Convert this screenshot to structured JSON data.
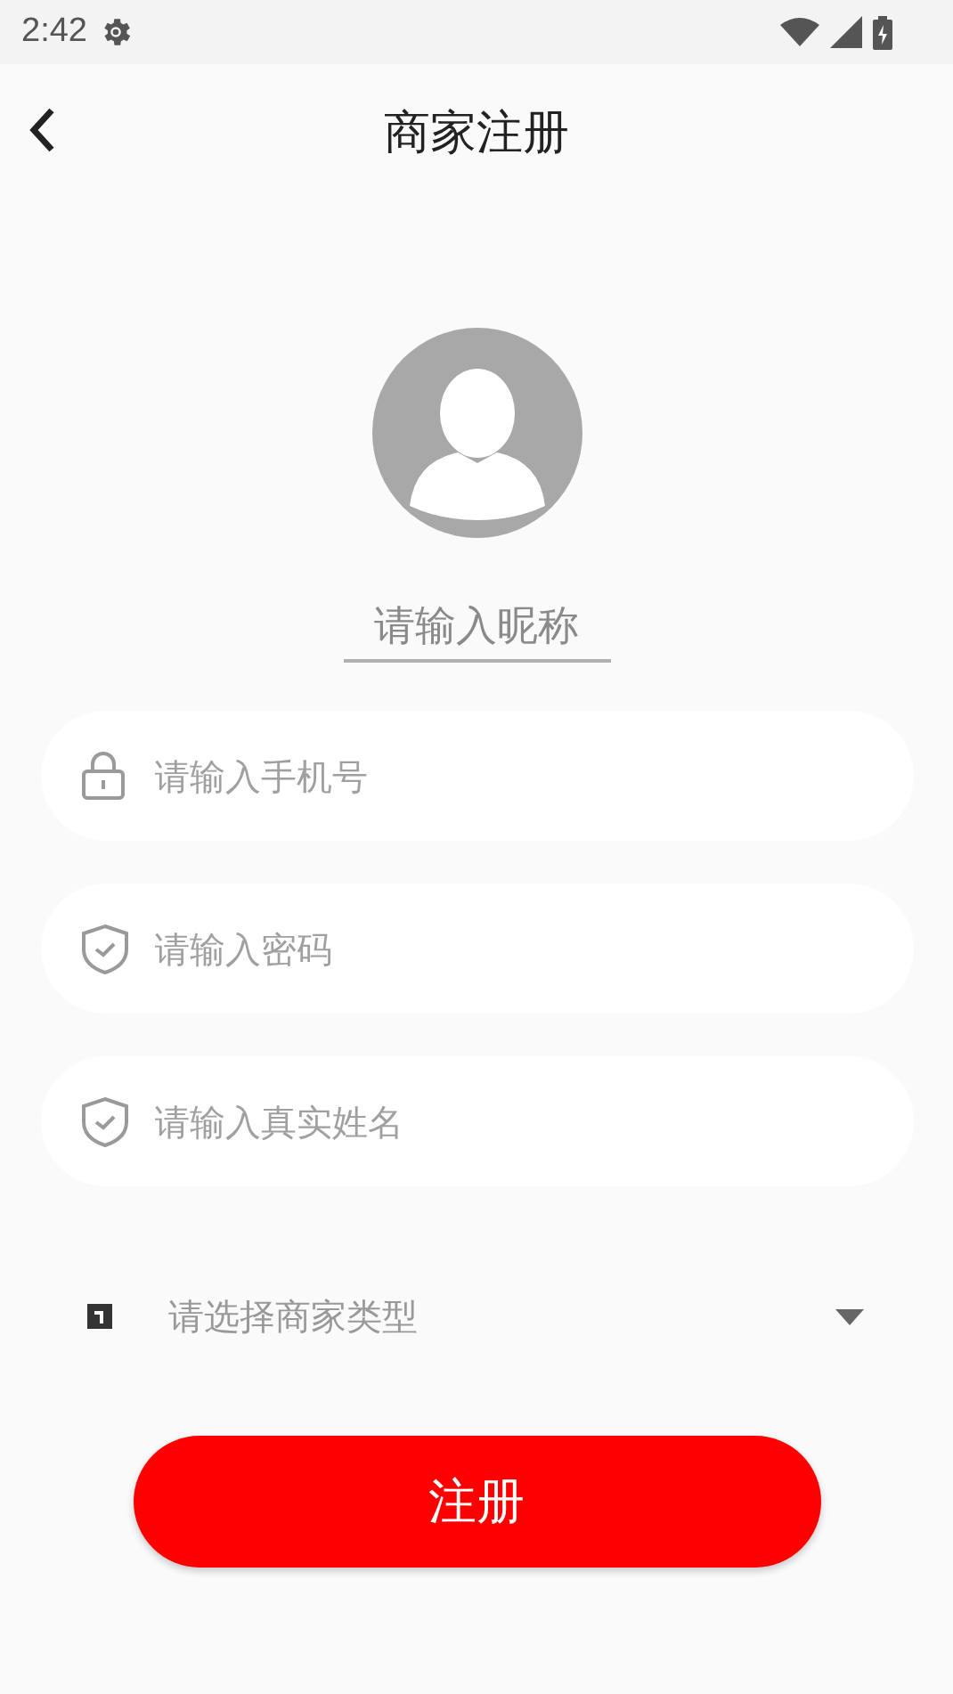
{
  "status_bar": {
    "time": "2:42"
  },
  "header": {
    "title": "商家注册"
  },
  "nickname": {
    "placeholder": "请输入昵称"
  },
  "fields": [
    {
      "kind": "phone",
      "placeholder": "请输入手机号"
    },
    {
      "kind": "password",
      "placeholder": "请输入密码"
    },
    {
      "kind": "realname",
      "placeholder": "请输入真实姓名"
    }
  ],
  "merchant_type": {
    "placeholder": "请选择商家类型"
  },
  "submit": {
    "label": "注册"
  }
}
